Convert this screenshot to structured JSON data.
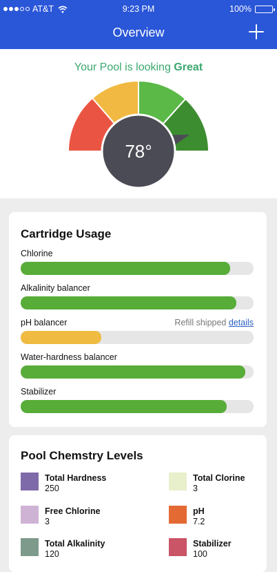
{
  "status_bar": {
    "carrier": "AT&T",
    "time": "9:23 PM",
    "battery": "100%"
  },
  "nav": {
    "title": "Overview",
    "add_icon": "plus-icon"
  },
  "overview": {
    "status_prefix": "Your Pool is looking",
    "status_value": "Great",
    "temperature": "78°",
    "gauge_level": 0.9,
    "gauge_colors": [
      "#ea5543",
      "#f1b941",
      "#5bb947",
      "#3c8d2f"
    ],
    "gauge_hub_color": "#4b4b55"
  },
  "cartridge_usage": {
    "title": "Cartridge Usage",
    "items": [
      {
        "label": "Chlorine",
        "level": 0.9,
        "color": "#58ac38"
      },
      {
        "label": "Alkalinity balancer",
        "level": 0.925,
        "color": "#58ac38"
      },
      {
        "label": "pH balancer",
        "level": 0.345,
        "color": "#efbb40",
        "note": "Refill shipped",
        "link": "details"
      },
      {
        "label": "Water-hardness balancer",
        "level": 0.965,
        "color": "#58ac38"
      },
      {
        "label": "Stabilizer",
        "level": 0.885,
        "color": "#58ac38"
      }
    ]
  },
  "chemistry": {
    "title": "Pool Chemstry Levels",
    "items": [
      {
        "name": "Total Hardness",
        "value": "250",
        "color": "#7e6aa9"
      },
      {
        "name": "Total Clorine",
        "value": "3",
        "color": "#e8efcb"
      },
      {
        "name": "Free Chlorine",
        "value": "3",
        "color": "#cfb3d5"
      },
      {
        "name": "pH",
        "value": "7.2",
        "color": "#e36a33"
      },
      {
        "name": "Total Alkalinity",
        "value": "120",
        "color": "#7d9a8b"
      },
      {
        "name": "Stabilizer",
        "value": "100",
        "color": "#c95567"
      }
    ]
  }
}
